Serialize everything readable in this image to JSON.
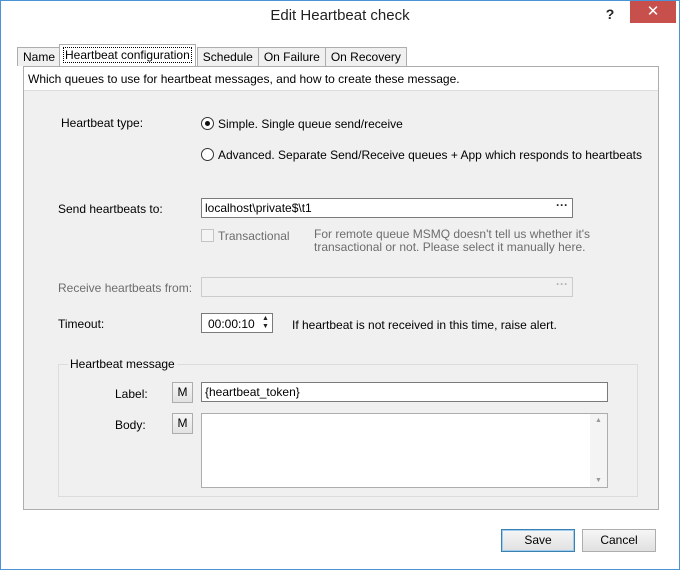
{
  "window": {
    "title": "Edit Heartbeat check",
    "help_glyph": "?",
    "close_glyph": "✕"
  },
  "tabs": [
    {
      "label": "Name"
    },
    {
      "label": "Heartbeat configuration"
    },
    {
      "label": "Schedule"
    },
    {
      "label": "On Failure"
    },
    {
      "label": "On Recovery"
    }
  ],
  "active_tab": "Heartbeat configuration",
  "description": "Which queues to use for heartbeat messages, and how to create these message.",
  "heartbeat_type": {
    "label": "Heartbeat type:",
    "options": [
      {
        "label": "Simple. Single queue send/receive",
        "selected": true
      },
      {
        "label": "Advanced. Separate Send/Receive queues + App which responds to heartbeats",
        "selected": false
      }
    ]
  },
  "send": {
    "label": "Send heartbeats to:",
    "value": "localhost\\private$\\t1",
    "browse_label": "···"
  },
  "transactional": {
    "label": "Transactional",
    "checked": false,
    "enabled": false,
    "note_line1": "For remote queue MSMQ doesn't tell us whether it's",
    "note_line2": "transactional or not. Please select it manually here."
  },
  "receive": {
    "label": "Receive heartbeats from:",
    "value": "",
    "enabled": false,
    "browse_label": "···"
  },
  "timeout": {
    "label": "Timeout:",
    "value": "00:00:10",
    "hint": "If heartbeat is not received in this time, raise alert."
  },
  "heartbeat_message": {
    "group_title": "Heartbeat message",
    "label_caption": "Label:",
    "label_value": "{heartbeat_token}",
    "body_caption": "Body:",
    "body_value": "",
    "macro_button_label": "M"
  },
  "buttons": {
    "save": "Save",
    "cancel": "Cancel"
  }
}
